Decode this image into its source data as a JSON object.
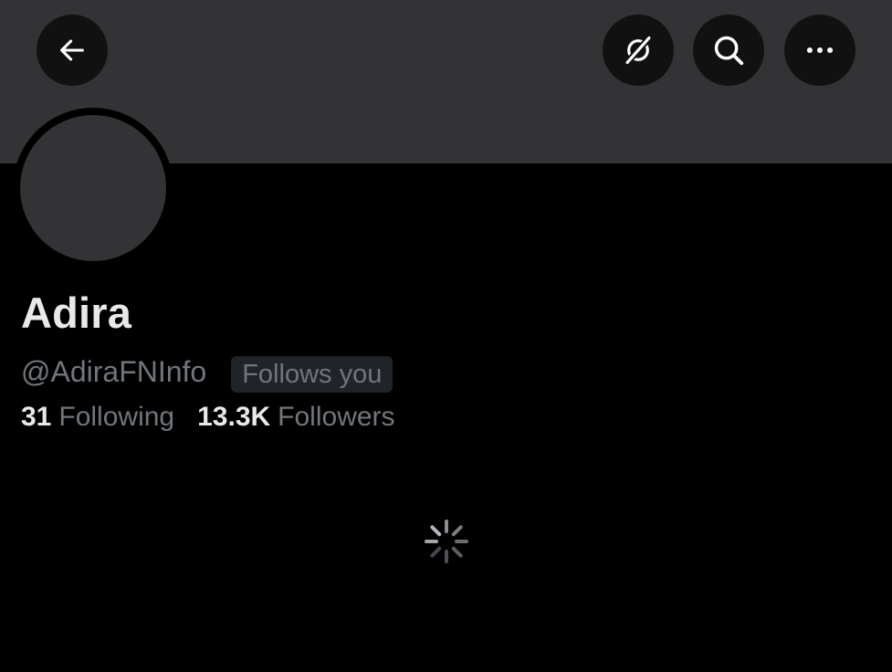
{
  "header": {
    "back_icon": "arrow-left-icon",
    "mute_icon": "notifications-off-icon",
    "search_icon": "search-icon",
    "more_icon": "more-horizontal-icon"
  },
  "profile": {
    "display_name": "Adira",
    "handle": "@AdiraFNInfo",
    "follows_you_label": "Follows you",
    "following_count": "31",
    "following_label": "Following",
    "followers_count": "13.3K",
    "followers_label": "Followers"
  },
  "colors": {
    "background": "#000000",
    "banner": "#333336",
    "button_bg": "#111112",
    "text_primary": "#e7e9ea",
    "text_secondary": "#71767b",
    "badge_bg": "#202327"
  },
  "loading": {
    "icon": "loading-spinner-icon"
  }
}
